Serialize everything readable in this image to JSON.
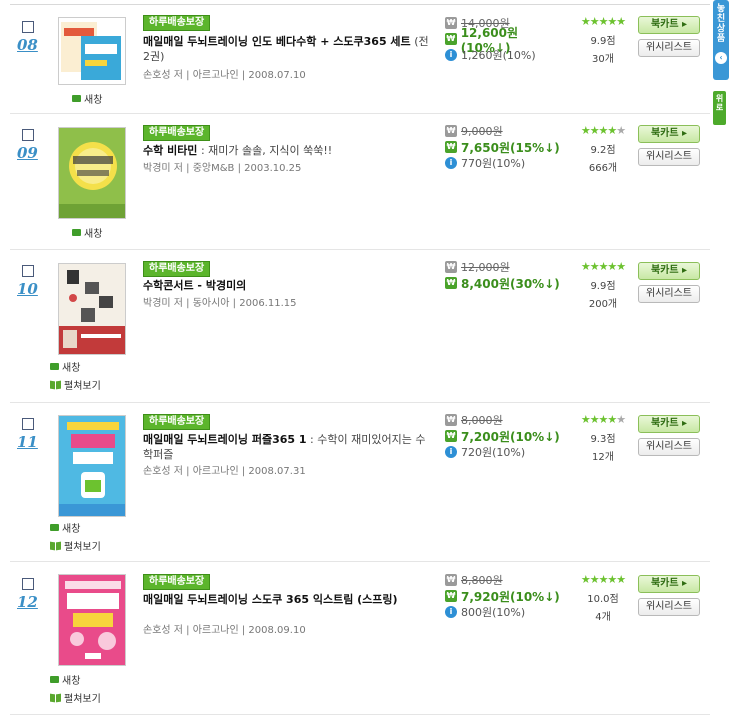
{
  "labels": {
    "badge": "하루배송보장",
    "new_window": "새창",
    "preview": "펼쳐보기",
    "cart_button": "북카트 ▸",
    "wish_button": "위시리스트"
  },
  "side_rail": {
    "label": "놓친 상품",
    "top": "위로"
  },
  "items": [
    {
      "rank": "08",
      "title": "매일매일 두뇌트레이닝 인도 베다수학 + 스도쿠365 세트",
      "title_extra": "(전2권)",
      "meta": "손호성 저 | 아르고나인 | 2008.07.10",
      "list_price": "14,000원",
      "sale_price": "12,600원(10%↓)",
      "points": "1,260원(10%)",
      "stars": 5,
      "score": "9.9점",
      "reviews": "30개",
      "has_preview": false,
      "cover": {
        "bg": "#ffffff",
        "accent": "#3aa9d9"
      }
    },
    {
      "rank": "09",
      "title": "수학 비타민",
      "title_extra": ": 재미가 솔솔, 지식이 쑥쑥!!",
      "meta": "박경미 저 | 중앙M&B | 2003.10.25",
      "list_price": "9,000원",
      "sale_price": "7,650원(15%↓)",
      "points": "770원(10%)",
      "stars": 4,
      "score": "9.2점",
      "reviews": "666개",
      "has_preview": false,
      "cover": {
        "bg": "#8fbf4a",
        "accent": "#f4e04a"
      }
    },
    {
      "rank": "10",
      "title": "수학콘서트 - 박경미의",
      "title_extra": "",
      "meta": "박경미 저 | 동아시아 | 2006.11.15",
      "list_price": "12,000원",
      "sale_price": "8,400원(30%↓)",
      "points": "",
      "stars": 5,
      "score": "9.9점",
      "reviews": "200개",
      "has_preview": true,
      "cover": {
        "bg": "#f4efe6",
        "accent": "#d24848"
      }
    },
    {
      "rank": "11",
      "title": "매일매일 두뇌트레이닝 퍼즐365 1",
      "title_extra": ": 수학이 재미있어지는 수학퍼즐",
      "meta": "손호성 저 | 아르고나인 | 2008.07.31",
      "list_price": "8,000원",
      "sale_price": "7,200원(10%↓)",
      "points": "720원(10%)",
      "stars": 4,
      "score": "9.3점",
      "reviews": "12개",
      "has_preview": true,
      "cover": {
        "bg": "#4fb9e3",
        "accent": "#f7d53c"
      }
    },
    {
      "rank": "12",
      "title": "매일매일 두뇌트레이닝 스도쿠 365 익스트림 (스프링)",
      "title_extra": "",
      "meta": "손호성 저 | 아르고나인 | 2008.09.10",
      "list_price": "8,800원",
      "sale_price": "7,920원(10%↓)",
      "points": "800원(10%)",
      "stars": 5,
      "score": "10.0점",
      "reviews": "4개",
      "has_preview": true,
      "cover": {
        "bg": "#e94b8a",
        "accent": "#ffffff"
      }
    }
  ],
  "colors": {
    "accent_green": "#5cb52c",
    "rank_blue": "#3a8fc6",
    "star_green": "#6cc22f"
  }
}
